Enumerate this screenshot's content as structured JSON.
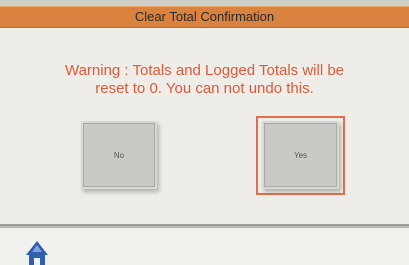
{
  "dialog": {
    "title": "Clear Total Confirmation",
    "warning_line1": "Warning : Totals and Logged Totals will be",
    "warning_line2": "reset to 0. You can not undo this.",
    "no_label": "No",
    "yes_label": "Yes",
    "focused_button": "yes"
  },
  "footer": {
    "icon": "home-icon"
  },
  "colors": {
    "title_bar": "#d9833e",
    "warning_text": "#dc5a3c",
    "button_face": "#c9c9c5",
    "focus_ring": "#e26e4f",
    "home_icon": "#2f5fb0"
  }
}
